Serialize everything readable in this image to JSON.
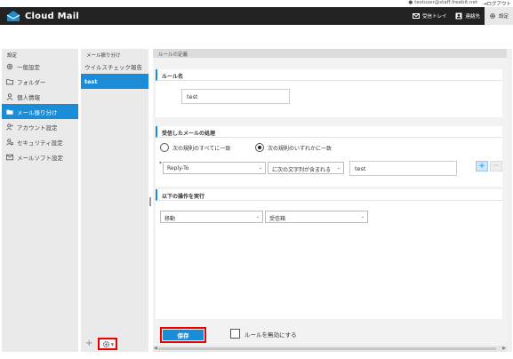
{
  "top": {
    "user_email": "testuser@staff.freebit.net",
    "logout_label": "ログアウト"
  },
  "header": {
    "app_name": "Cloud Mail",
    "nav": [
      {
        "label": "受信トレイ",
        "icon": "inbox-icon"
      },
      {
        "label": "連絡先",
        "icon": "contacts-icon"
      },
      {
        "label": "設定",
        "icon": "gear-icon"
      }
    ]
  },
  "sidebar": {
    "title": "設定",
    "items": [
      {
        "label": "一般設定",
        "icon": "gear-icon"
      },
      {
        "label": "フォルダー",
        "icon": "folder-icon"
      },
      {
        "label": "個人情報",
        "icon": "person-icon"
      },
      {
        "label": "メール振り分け",
        "icon": "folder-filled-icon"
      },
      {
        "label": "アカウント設定",
        "icon": "account-icon"
      },
      {
        "label": "セキュリティ設定",
        "icon": "security-icon"
      },
      {
        "label": "メールソフト設定",
        "icon": "mail-client-icon"
      }
    ]
  },
  "rulelist": {
    "title": "メール振り分け",
    "items": [
      "ウイルスチェック報告",
      "test"
    ],
    "add_symbol": "+"
  },
  "main": {
    "title": "ルールの定義",
    "rule_name_section": {
      "heading": "ルール名",
      "value": "test"
    },
    "conditions_section": {
      "heading": "受信したメールの処理",
      "radio_all": "次の規則のすべてに一致",
      "radio_any": "次の規則のいずれかに一致",
      "required_mark": "*",
      "header_select": "Reply-To",
      "operator_select": "に次の文字列が含まれる",
      "match_value": "test",
      "add_symbol": "+",
      "remove_symbol": "−"
    },
    "actions_section": {
      "heading": "以下の操作を実行",
      "action_select": "移動",
      "folder_select": "受信箱"
    },
    "save_label": "保存",
    "disable_label": "ルールを無効にする"
  },
  "colors": {
    "accent": "#1a8dd6",
    "header_bg": "#222222",
    "highlight_border": "#ee0000"
  }
}
